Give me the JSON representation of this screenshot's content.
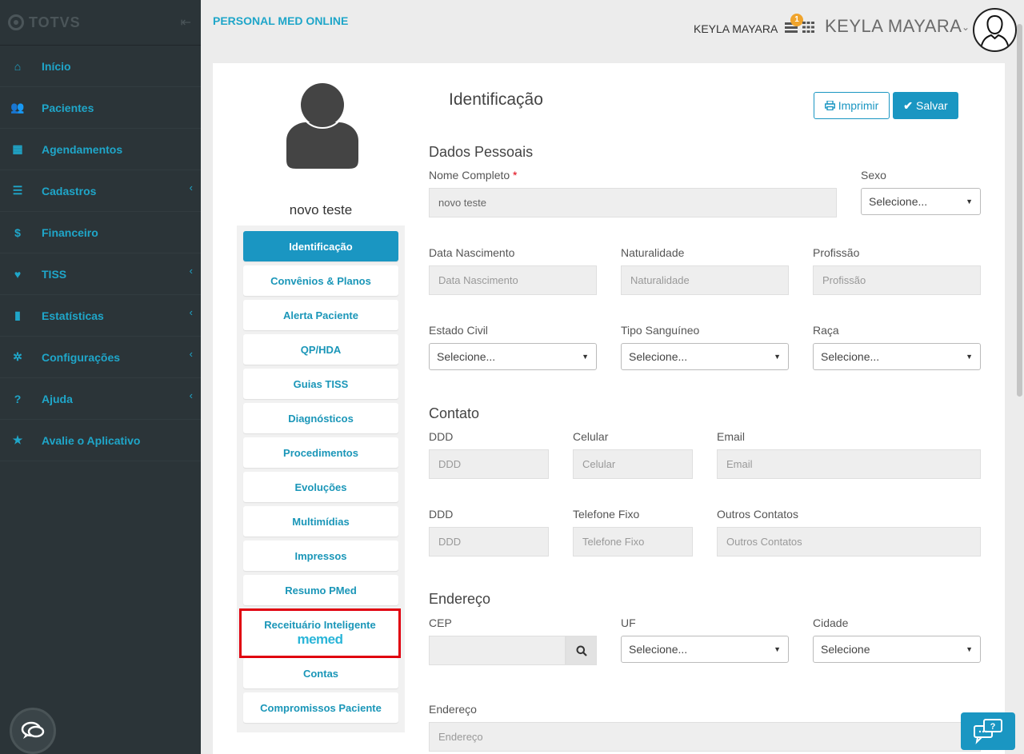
{
  "sidebar": {
    "brand": "TOTVS",
    "items": [
      {
        "label": "Início",
        "icon": "home-icon",
        "glyph": "⌂",
        "chevron": false
      },
      {
        "label": "Pacientes",
        "icon": "users-icon",
        "glyph": "👥",
        "chevron": false
      },
      {
        "label": "Agendamentos",
        "icon": "calendar-icon",
        "glyph": "▦",
        "chevron": false
      },
      {
        "label": "Cadastros",
        "icon": "list-icon",
        "glyph": "☰",
        "chevron": true
      },
      {
        "label": "Financeiro",
        "icon": "dollar-icon",
        "glyph": "$",
        "chevron": false
      },
      {
        "label": "TISS",
        "icon": "heartbeat-icon",
        "glyph": "♥",
        "chevron": true
      },
      {
        "label": "Estatísticas",
        "icon": "bar-chart-icon",
        "glyph": "▮",
        "chevron": true
      },
      {
        "label": "Configurações",
        "icon": "gear-icon",
        "glyph": "✲",
        "chevron": true
      },
      {
        "label": "Ajuda",
        "icon": "question-icon",
        "glyph": "?",
        "chevron": true
      },
      {
        "label": "Avalie o Aplicativo",
        "icon": "star-icon",
        "glyph": "★",
        "chevron": false
      }
    ]
  },
  "header": {
    "app_title": "PERSONAL MED ONLINE",
    "user_small": "KEYLA MAYARA",
    "notification_count": "1",
    "user_big": "KEYLA MAYARA"
  },
  "patient": {
    "name": "novo teste"
  },
  "patient_menu": [
    "Identificação",
    "Convênios & Planos",
    "Alerta Paciente",
    "QP/HDA",
    "Guias TISS",
    "Diagnósticos",
    "Procedimentos",
    "Evoluções",
    "Multimídias",
    "Impressos",
    "Resumo PMed",
    "Contas",
    "Compromissos Paciente"
  ],
  "memed": {
    "label": "Receituário Inteligente",
    "logo": "memed"
  },
  "form": {
    "title": "Identificação",
    "print_label": "Imprimir",
    "save_label": "Salvar",
    "dados_pessoais": "Dados Pessoais",
    "nome_label": "Nome Completo",
    "nome_required": "*",
    "nome_value": "novo teste",
    "sexo_label": "Sexo",
    "sexo_value": "Selecione...",
    "nascimento_label": "Data Nascimento",
    "nascimento_placeholder": "Data Nascimento",
    "naturalidade_label": "Naturalidade",
    "naturalidade_placeholder": "Naturalidade",
    "profissao_label": "Profissão",
    "profissao_placeholder": "Profissão",
    "estado_civil_label": "Estado Civil",
    "estado_civil_value": "Selecione...",
    "tipo_sanguineo_label": "Tipo Sanguíneo",
    "tipo_sanguineo_value": "Selecione...",
    "raca_label": "Raça",
    "raca_value": "Selecione...",
    "contato": "Contato",
    "ddd1_label": "DDD",
    "ddd1_placeholder": "DDD",
    "celular_label": "Celular",
    "celular_placeholder": "Celular",
    "email_label": "Email",
    "email_placeholder": "Email",
    "ddd2_label": "DDD",
    "ddd2_placeholder": "DDD",
    "telefone_label": "Telefone Fixo",
    "telefone_placeholder": "Telefone Fixo",
    "outros_label": "Outros Contatos",
    "outros_placeholder": "Outros Contatos",
    "endereco_section": "Endereço",
    "cep_label": "CEP",
    "uf_label": "UF",
    "uf_value": "Selecione...",
    "cidade_label": "Cidade",
    "cidade_value": "Selecione",
    "endereco_label": "Endereço",
    "endereco_placeholder": "Endereço"
  }
}
